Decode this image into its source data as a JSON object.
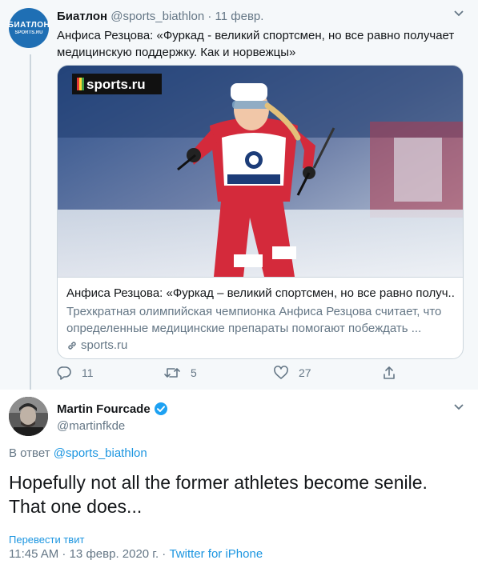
{
  "parent_tweet": {
    "author_name": "Биатлон",
    "author_handle": "@sports_biathlon",
    "separator": " · ",
    "date": "11 февр.",
    "avatar_text": [
      "БИАТЛОН",
      "SPORTS.RU"
    ],
    "text": "Анфиса Резцова: «Фуркад - великий спортсмен, но все равно получает медицинскую поддержку. Как и норвежцы»",
    "card": {
      "image_watermark": "sports.ru",
      "title": "Анфиса Резцова: «Фуркад – великий спортсмен, но все равно получ...",
      "description": "Трехкратная олимпийская чемпионка Анфиса Резцова считает, что определенные медицинские препараты помогают побеждать ...",
      "domain": "sports.ru"
    },
    "actions": {
      "reply_count": "11",
      "retweet_count": "5",
      "like_count": "27"
    }
  },
  "reply_tweet": {
    "author_name": "Martin Fourcade",
    "author_handle": "@martinfkde",
    "verified": true,
    "reply_to_prefix": "В ответ",
    "reply_to_handle": "@sports_biathlon",
    "text": "Hopefully not all the former athletes become senile. That one does...",
    "translate_label": "Перевести твит",
    "time": "11:45 AM · 13 февр. 2020 г. · ",
    "source": "Twitter for iPhone"
  },
  "colors": {
    "accent": "#1b95e0",
    "muted": "#657786",
    "background_parent": "#f5f8fa",
    "border": "#ccd6dd",
    "verified": "#1da1f2"
  }
}
